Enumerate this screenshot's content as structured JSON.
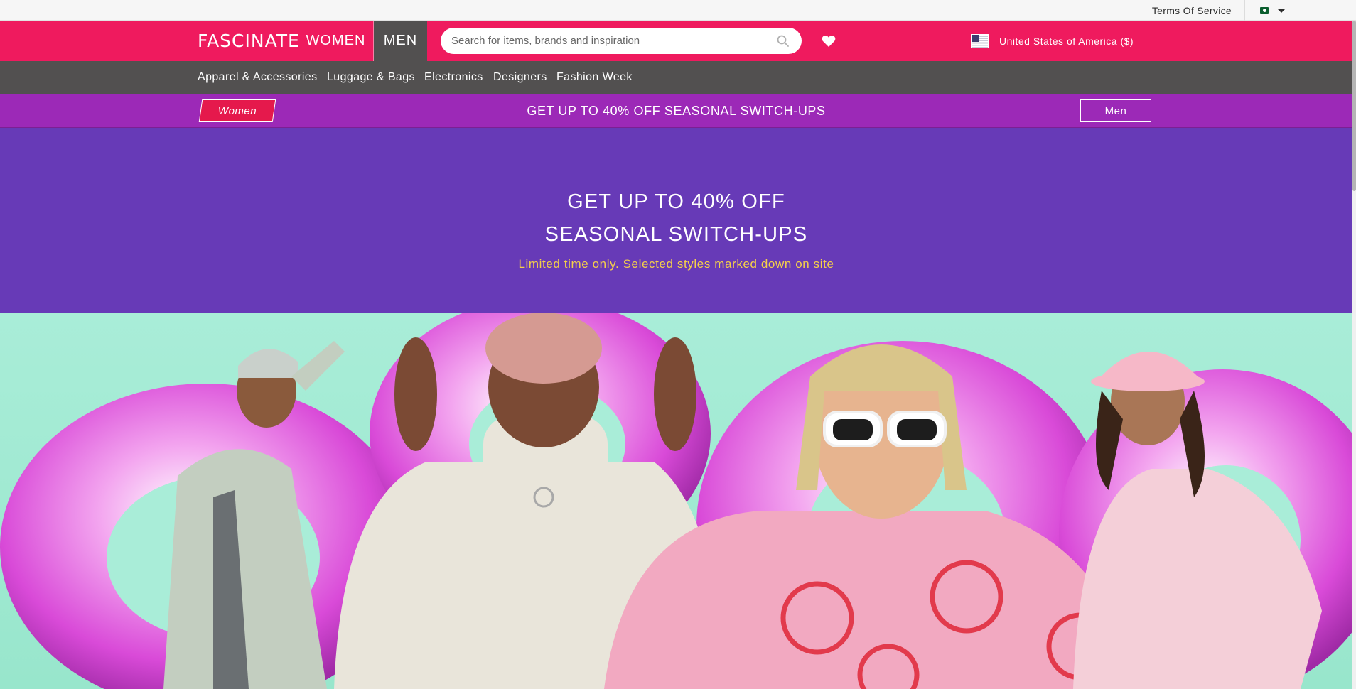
{
  "utility_bar": {
    "terms_label": "Terms Of Service",
    "country_flag_icon": "pakistan-flag-icon"
  },
  "header": {
    "logo": "FASCINATE",
    "tabs": [
      {
        "label": "WOMEN",
        "active": false
      },
      {
        "label": "MEN",
        "active": true
      }
    ],
    "search": {
      "value": "",
      "placeholder": "Search for items, brands and inspiration",
      "icon": "search-icon"
    },
    "wishlist_icon": "heart-icon",
    "country": {
      "label": "United States of America ($)",
      "flag_icon": "us-flag-icon"
    }
  },
  "category_nav": {
    "items": [
      "Apparel & Accessories",
      "Luggage & Bags",
      "Electronics",
      "Designers",
      "Fashion Week"
    ]
  },
  "promo_bar": {
    "left_button": "Women",
    "text": "GET UP TO 40% OFF SEASONAL SWITCH-UPS",
    "right_button": "Men"
  },
  "hero": {
    "headline_line1": "GET UP TO 40% OFF",
    "headline_line2": "SEASONAL SWITCH-UPS",
    "subtext": "Limited time only. Selected styles marked down on site"
  },
  "colors": {
    "brand_pink": "#ef1a5e",
    "nav_gray": "#525050",
    "promo_purple": "#9c29b7",
    "hero_purple": "#673ab7",
    "hero_subtext_yellow": "#f5d04a",
    "campaign_mint": "#a6ecd6",
    "campaign_magenta": "#e04fe0"
  }
}
